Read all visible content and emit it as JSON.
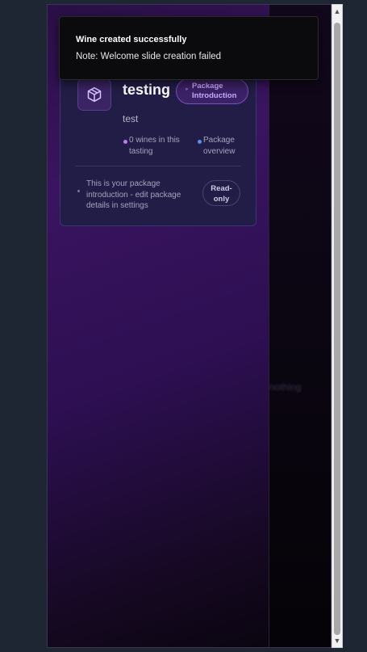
{
  "toast": {
    "title": "Wine created successfully",
    "description": "Note: Welcome slide creation failed"
  },
  "package_card": {
    "icon": "package-icon",
    "title": "testing",
    "badge_label": "Package Introduction",
    "badge_icon": "link-icon",
    "description": "test",
    "stats": [
      {
        "label": "0 wines in this tasting",
        "color": "#c07cf0"
      },
      {
        "label": "Package overview",
        "color": "#5b8def"
      }
    ],
    "info_text": "This is your package introduction - edit package details in settings",
    "readonly_label": "Read-only"
  },
  "right_pane": {
    "ghost_text": "nothing"
  },
  "colors": {
    "accent": "#7a4fc0",
    "background": "#1e2533",
    "card": "#211e44"
  }
}
